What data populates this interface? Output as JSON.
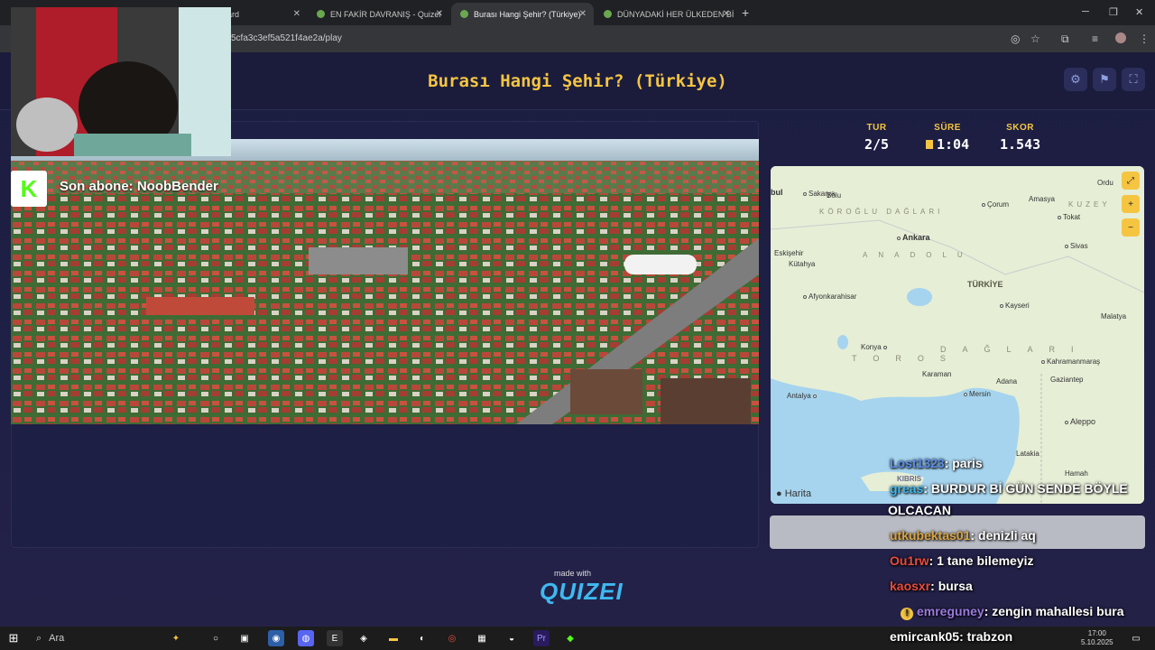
{
  "browser": {
    "tabs": [
      {
        "label": "Dashboard"
      },
      {
        "label": "EN FAKİR DAVRANIŞ - Quizei"
      },
      {
        "label": "Burası Hangi Şehir? (Türkiye) - Q"
      },
      {
        "label": "DÜNYADAKİ HER ÜLKEDEN Bİ"
      }
    ],
    "url": "5cfa3c3ef5a521f4ae2a/play"
  },
  "page": {
    "title": "Burası Hangi Şehir? (Türkiye)"
  },
  "stats": {
    "round_label": "TUR",
    "round_value": "2/5",
    "time_label": "SÜRE",
    "time_value": "1:04",
    "score_label": "SKOR",
    "score_value": "1.543"
  },
  "stream": {
    "sub_text": "Son abone: NoobBender"
  },
  "map": {
    "attribution": "Harita",
    "country_label": "TÜRKİYE",
    "cities": [
      {
        "name": "Sakarya"
      },
      {
        "name": "Bolu"
      },
      {
        "name": "Çorum"
      },
      {
        "name": "Amasya"
      },
      {
        "name": "Tokat"
      },
      {
        "name": "Ordu"
      },
      {
        "name": "Ankara"
      },
      {
        "name": "Sivas"
      },
      {
        "name": "Eskişehir"
      },
      {
        "name": "Kütahya"
      },
      {
        "name": "Afyonkarahisar"
      },
      {
        "name": "Kayseri"
      },
      {
        "name": "Malatya"
      },
      {
        "name": "Konya"
      },
      {
        "name": "Kahramanmaraş"
      },
      {
        "name": "Karaman"
      },
      {
        "name": "Gaziantep"
      },
      {
        "name": "Adana"
      },
      {
        "name": "Antalya"
      },
      {
        "name": "Mersin"
      },
      {
        "name": "Aleppo"
      },
      {
        "name": "Latakia"
      },
      {
        "name": "Hamah"
      },
      {
        "name": "KIBRIS"
      },
      {
        "name": "bul"
      }
    ],
    "regions": [
      {
        "name": "KÖROĞLU DAĞLARI"
      },
      {
        "name": "ANADOLU"
      },
      {
        "name": "KUZEY"
      },
      {
        "name": "TOROS"
      },
      {
        "name": "DAĞLARI"
      }
    ]
  },
  "footer": {
    "made_with": "made with",
    "logo": "QUIZEI"
  },
  "chat": [
    {
      "user": "Lost1323",
      "msg": ": paris",
      "color": "#5b8de8"
    },
    {
      "user": "greas",
      "msg": ": BURDUR Bİ GÜN SENDE BÖYLE",
      "color": "#3fb8f0"
    },
    {
      "user": "",
      "msg": "OLCACAN",
      "color": "#ffffff"
    },
    {
      "user": "utkubektas01",
      "msg": ": denizli aq",
      "color": "#d9a441"
    },
    {
      "user": "Ou1rw",
      "msg": ": 1 tane bilemeyiz",
      "color": "#e84c3d"
    },
    {
      "user": "kaosxr",
      "msg": ": bursa",
      "color": "#e84c3d"
    },
    {
      "user": "emreguney",
      "msg": ": zengin mahallesi bura",
      "color": "#9b7be0"
    },
    {
      "user": "emircank05",
      "msg": ": trabzon",
      "color": "#ffffff"
    }
  ],
  "taskbar": {
    "search_label": "Ara",
    "time": "17:00",
    "date": "5.10.2025"
  }
}
